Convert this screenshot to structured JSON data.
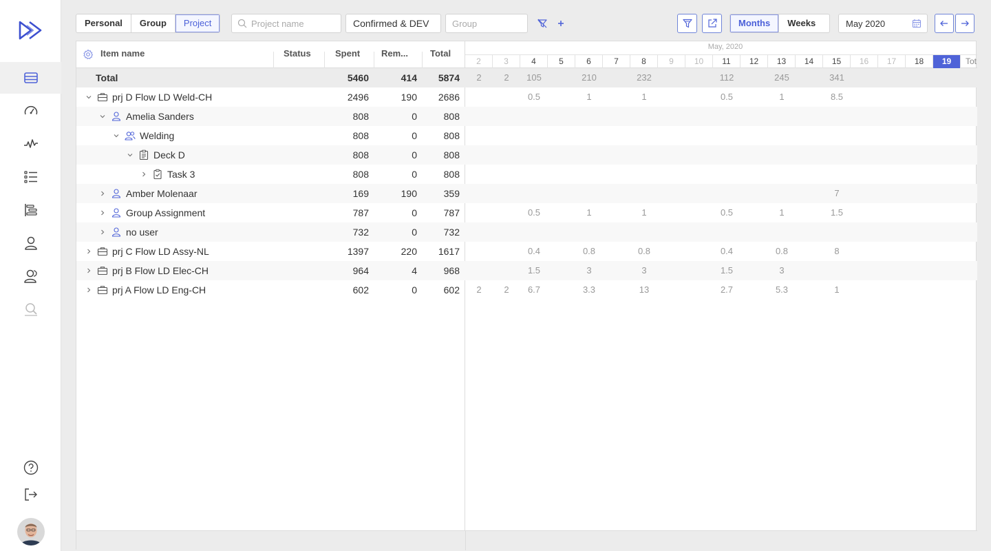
{
  "toolbar": {
    "view_tabs": [
      {
        "label": "Personal",
        "active": false
      },
      {
        "label": "Group",
        "active": false
      },
      {
        "label": "Project",
        "active": true
      }
    ],
    "project_search_placeholder": "Project name",
    "status_filter_value": "Confirmed & DEV",
    "group_placeholder": "Group",
    "period_tabs": [
      {
        "label": "Months",
        "active": true
      },
      {
        "label": "Weeks",
        "active": false
      }
    ],
    "date_value": "May 2020"
  },
  "grid": {
    "headers": {
      "name": "Item name",
      "status": "Status",
      "spent": "Spent",
      "remaining": "Rem...",
      "total": "Total"
    },
    "rows": [
      {
        "label": "Total",
        "type": "total",
        "level": 0,
        "chevron": "",
        "icon": "",
        "spent": "5460",
        "remaining": "414",
        "total": "5874"
      },
      {
        "label": "prj D Flow LD Weld-CH",
        "type": "project",
        "level": 0,
        "chevron": "down",
        "icon": "briefcase-icon",
        "spent": "2496",
        "remaining": "190",
        "total": "2686"
      },
      {
        "label": "Amelia Sanders",
        "type": "user",
        "level": 1,
        "chevron": "down",
        "icon": "user-icon",
        "spent": "808",
        "remaining": "0",
        "total": "808"
      },
      {
        "label": "Welding",
        "type": "group",
        "level": 2,
        "chevron": "down",
        "icon": "group-icon",
        "spent": "808",
        "remaining": "0",
        "total": "808"
      },
      {
        "label": "Deck D",
        "type": "tasklist",
        "level": 3,
        "chevron": "down",
        "icon": "clipboard-icon",
        "spent": "808",
        "remaining": "0",
        "total": "808"
      },
      {
        "label": "Task 3",
        "type": "task",
        "level": 4,
        "chevron": "right",
        "icon": "task-icon",
        "spent": "808",
        "remaining": "0",
        "total": "808"
      },
      {
        "label": "Amber Molenaar",
        "type": "user",
        "level": 1,
        "chevron": "right",
        "icon": "user-icon",
        "spent": "169",
        "remaining": "190",
        "total": "359"
      },
      {
        "label": "Group Assignment",
        "type": "user",
        "level": 1,
        "chevron": "right",
        "icon": "user-icon",
        "spent": "787",
        "remaining": "0",
        "total": "787"
      },
      {
        "label": "no user",
        "type": "user",
        "level": 1,
        "chevron": "right",
        "icon": "user-icon",
        "spent": "732",
        "remaining": "0",
        "total": "732"
      },
      {
        "label": "prj C Flow LD Assy-NL",
        "type": "project",
        "level": 0,
        "chevron": "right",
        "icon": "briefcase-icon",
        "spent": "1397",
        "remaining": "220",
        "total": "1617"
      },
      {
        "label": "prj B Flow LD Elec-CH",
        "type": "project",
        "level": 0,
        "chevron": "right",
        "icon": "briefcase-icon",
        "spent": "964",
        "remaining": "4",
        "total": "968"
      },
      {
        "label": "prj A Flow LD Eng-CH",
        "type": "project",
        "level": 0,
        "chevron": "right",
        "icon": "briefcase-icon",
        "spent": "602",
        "remaining": "0",
        "total": "602"
      }
    ]
  },
  "calendar": {
    "month_label": "May, 2020",
    "days": [
      {
        "label": "2",
        "weekend": true
      },
      {
        "label": "3",
        "weekend": true
      },
      {
        "label": "4",
        "weekend": false
      },
      {
        "label": "5",
        "weekend": false
      },
      {
        "label": "6",
        "weekend": false
      },
      {
        "label": "7",
        "weekend": false
      },
      {
        "label": "8",
        "weekend": false
      },
      {
        "label": "9",
        "weekend": true
      },
      {
        "label": "10",
        "weekend": true
      },
      {
        "label": "11",
        "weekend": false
      },
      {
        "label": "12",
        "weekend": false
      },
      {
        "label": "13",
        "weekend": false
      },
      {
        "label": "14",
        "weekend": false
      },
      {
        "label": "15",
        "weekend": false
      },
      {
        "label": "16",
        "weekend": true
      },
      {
        "label": "17",
        "weekend": true
      },
      {
        "label": "18",
        "weekend": false
      },
      {
        "label": "19",
        "weekend": false,
        "today": true
      }
    ],
    "total_col_label": "Tot",
    "cells": [
      [
        "2",
        "2",
        "105",
        "",
        "210",
        "",
        "232",
        "",
        "",
        "112",
        "",
        "245",
        "",
        "341",
        "",
        "",
        "",
        ""
      ],
      [
        "",
        "",
        "0.5",
        "",
        "1",
        "",
        "1",
        "",
        "",
        "0.5",
        "",
        "1",
        "",
        "8.5",
        "",
        "",
        "",
        ""
      ],
      [
        "",
        "",
        "",
        "",
        "",
        "",
        "",
        "",
        "",
        "",
        "",
        "",
        "",
        "",
        "",
        "",
        "",
        ""
      ],
      [
        "",
        "",
        "",
        "",
        "",
        "",
        "",
        "",
        "",
        "",
        "",
        "",
        "",
        "",
        "",
        "",
        "",
        ""
      ],
      [
        "",
        "",
        "",
        "",
        "",
        "",
        "",
        "",
        "",
        "",
        "",
        "",
        "",
        "",
        "",
        "",
        "",
        ""
      ],
      [
        "",
        "",
        "",
        "",
        "",
        "",
        "",
        "",
        "",
        "",
        "",
        "",
        "",
        "",
        "",
        "",
        "",
        ""
      ],
      [
        "",
        "",
        "",
        "",
        "",
        "",
        "",
        "",
        "",
        "",
        "",
        "",
        "",
        "7",
        "",
        "",
        "",
        ""
      ],
      [
        "",
        "",
        "0.5",
        "",
        "1",
        "",
        "1",
        "",
        "",
        "0.5",
        "",
        "1",
        "",
        "1.5",
        "",
        "",
        "",
        ""
      ],
      [
        "",
        "",
        "",
        "",
        "",
        "",
        "",
        "",
        "",
        "",
        "",
        "",
        "",
        "",
        "",
        "",
        "",
        ""
      ],
      [
        "",
        "",
        "0.4",
        "",
        "0.8",
        "",
        "0.8",
        "",
        "",
        "0.4",
        "",
        "0.8",
        "",
        "8",
        "",
        "",
        "",
        ""
      ],
      [
        "",
        "",
        "1.5",
        "",
        "3",
        "",
        "3",
        "",
        "",
        "1.5",
        "",
        "3",
        "",
        "",
        "",
        "",
        "",
        ""
      ],
      [
        "2",
        "2",
        "6.7",
        "",
        "3.3",
        "",
        "13",
        "",
        "",
        "2.7",
        "",
        "5.3",
        "",
        "1",
        "",
        "",
        "",
        ""
      ]
    ]
  },
  "colors": {
    "accent": "#4f63d8",
    "accent_light": "#8795e6"
  }
}
